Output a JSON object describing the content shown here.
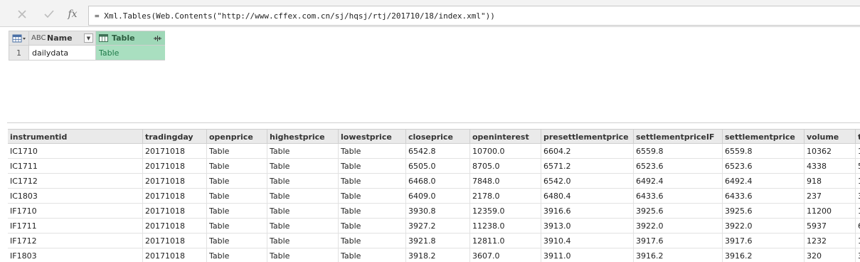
{
  "formula_bar": {
    "formula": "= Xml.Tables(Web.Contents(\"http://www.cffex.com.cn/sj/hqsj/rtj/201710/18/index.xml\"))",
    "fx_label": "fx"
  },
  "result_table": {
    "columns": [
      {
        "type": "ABC",
        "name": "Name"
      },
      {
        "name": "Table"
      }
    ],
    "rows": [
      {
        "index": "1",
        "name": "dailydata",
        "table": "Table"
      }
    ]
  },
  "preview": {
    "columns": [
      "instrumentid",
      "tradingday",
      "openprice",
      "highestprice",
      "lowestprice",
      "closeprice",
      "openinterest",
      "presettlementprice",
      "settlementpriceIF",
      "settlementprice",
      "volume",
      "t"
    ],
    "rows": [
      [
        "IC1710",
        "20171018",
        "Table",
        "Table",
        "Table",
        "6542.8",
        "10700.0",
        "6604.2",
        "6559.8",
        "6559.8",
        "10362",
        "1"
      ],
      [
        "IC1711",
        "20171018",
        "Table",
        "Table",
        "Table",
        "6505.0",
        "8705.0",
        "6571.2",
        "6523.6",
        "6523.6",
        "4338",
        "5"
      ],
      [
        "IC1712",
        "20171018",
        "Table",
        "Table",
        "Table",
        "6468.0",
        "7848.0",
        "6542.0",
        "6492.4",
        "6492.4",
        "918",
        "1"
      ],
      [
        "IC1803",
        "20171018",
        "Table",
        "Table",
        "Table",
        "6409.0",
        "2178.0",
        "6480.4",
        "6433.6",
        "6433.6",
        "237",
        "3"
      ],
      [
        "IF1710",
        "20171018",
        "Table",
        "Table",
        "Table",
        "3930.8",
        "12359.0",
        "3916.6",
        "3925.6",
        "3925.6",
        "11200",
        "1"
      ],
      [
        "IF1711",
        "20171018",
        "Table",
        "Table",
        "Table",
        "3927.2",
        "11238.0",
        "3913.0",
        "3922.0",
        "3922.0",
        "5937",
        "6"
      ],
      [
        "IF1712",
        "20171018",
        "Table",
        "Table",
        "Table",
        "3921.8",
        "12811.0",
        "3910.4",
        "3917.6",
        "3917.6",
        "1232",
        "1"
      ],
      [
        "IF1803",
        "20171018",
        "Table",
        "Table",
        "Table",
        "3918.2",
        "3607.0",
        "3911.0",
        "3916.2",
        "3916.2",
        "320",
        "3"
      ]
    ]
  }
}
